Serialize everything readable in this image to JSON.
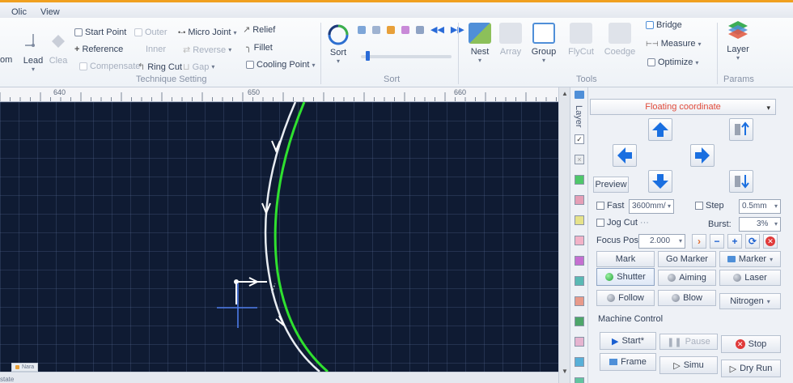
{
  "menu": {
    "items": [
      "Olic",
      "View"
    ]
  },
  "ribbon": {
    "technique": {
      "label": "Technique Setting",
      "lead": "Lead",
      "clear": "Clea",
      "cut_left": "om",
      "start_point": "Start Point",
      "reference": "Reference",
      "compensate": "Compensate",
      "outer": "Outer",
      "inner": "Inner",
      "ring_cut": "Ring Cut",
      "micro_joint": "Micro Joint",
      "reverse": "Reverse",
      "gap": "Gap",
      "relief": "Relief",
      "fillet": "Fillet",
      "cooling_point": "Cooling Point"
    },
    "sort": {
      "label": "Sort",
      "sort_button": "Sort",
      "slider_value": 0.05
    },
    "tools": {
      "label": "Tools",
      "nest": "Nest",
      "array": "Array",
      "group": "Group",
      "flycut": "FlyCut",
      "coedge": "Coedge",
      "bridge": "Bridge",
      "measure": "Measure",
      "optimize": "Optimize"
    },
    "params": {
      "label": "Params",
      "layer": "Layer"
    }
  },
  "ruler": {
    "ticks": [
      "640",
      "650",
      "660"
    ]
  },
  "layers": {
    "label": "Layer",
    "swatches": [
      "#ffffff",
      "#e9ecef",
      "#4fc76a",
      "#e59fb6",
      "#e6e28a",
      "#f2b2c7",
      "#c56fd1",
      "#5ab9b4",
      "#e89a8a",
      "#4ea66a",
      "#e6b4d0",
      "#58b0d8",
      "#62c4a0"
    ]
  },
  "panel": {
    "coordinate": "Floating coordinate",
    "preview": "Preview",
    "fast": "Fast",
    "speed": "3600mm/",
    "step": "Step",
    "step_value": "0.5mm",
    "jog_cut": "Jog Cut",
    "burst": "Burst:",
    "burst_value": "3%",
    "focus_pos": "Focus Pos",
    "focus_value": "2.000",
    "mark": "Mark",
    "go_marker": "Go Marker",
    "marker": "Marker",
    "shutter": "Shutter",
    "aiming": "Aiming",
    "laser": "Laser",
    "follow": "Follow",
    "blow": "Blow",
    "nitrogen": "Nitrogen",
    "machine_control": "Machine Control",
    "start": "Start*",
    "pause": "Pause",
    "stop": "Stop",
    "frame": "Frame",
    "simu": "Simu",
    "dry_run": "Dry Run"
  },
  "status": {
    "tab": "Nara",
    "left_text": "state"
  },
  "colors": {
    "accent_red": "#e04a3a",
    "arrow_blue": "#1a6fe0",
    "path_green": "#2fe02f",
    "canvas_bg": "#0f1b33"
  }
}
